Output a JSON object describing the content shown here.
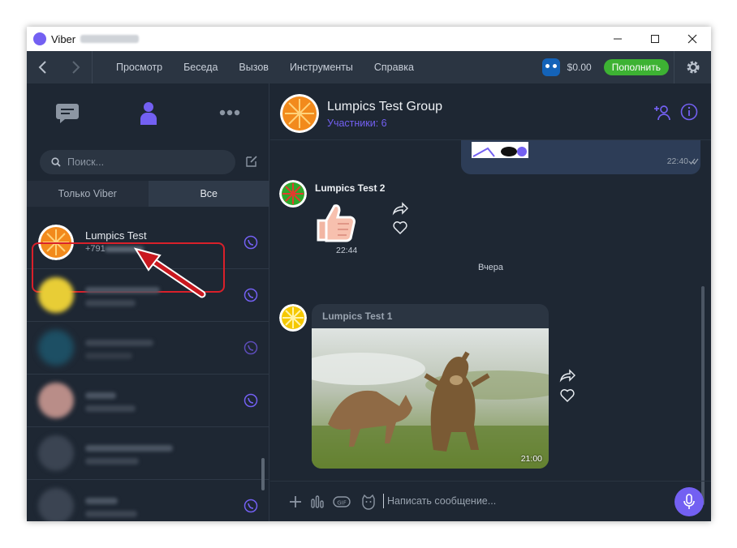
{
  "window": {
    "title": "Viber"
  },
  "menu": {
    "items": [
      "Просмотр",
      "Беседа",
      "Вызов",
      "Инструменты",
      "Справка"
    ],
    "balance": "$0.00",
    "topup_label": "Пополнить"
  },
  "sidebar": {
    "search_placeholder": "Поиск...",
    "filters": [
      "Только Viber",
      "Все"
    ],
    "contacts": [
      {
        "name": "Lumpics Test",
        "phone": "+791"
      }
    ]
  },
  "chat": {
    "group_name": "Lumpics Test Group",
    "members": "Участники: 6",
    "out_time": "22:40",
    "msg1_sender": "Lumpics Test 2",
    "msg1_time": "22:44",
    "day_separator": "Вчера",
    "msg2_sender": "Lumpics Test 1",
    "msg2_time": "21:00",
    "composer_placeholder": "Написать сообщение..."
  },
  "colors": {
    "accent": "#7360f2",
    "topup": "#3db233",
    "highlight": "#d9202a",
    "background": "#1e2733"
  }
}
